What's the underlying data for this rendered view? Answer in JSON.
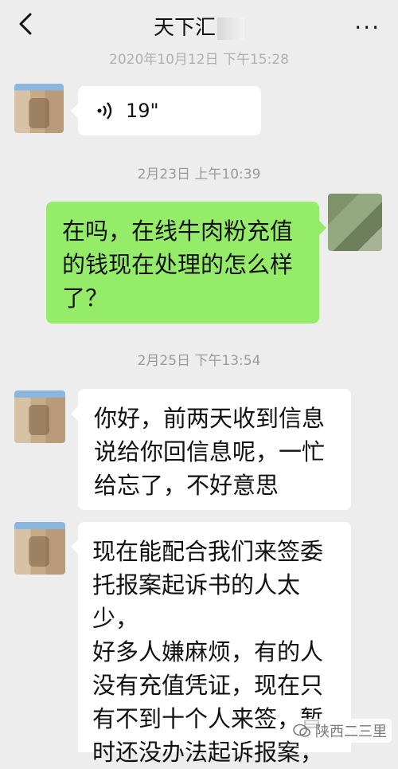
{
  "header": {
    "title": "天下汇",
    "more_label": "···"
  },
  "timestamps": {
    "ts1": "2020年10月12日 下午15:28",
    "ts2": "2月23日 上午10:39",
    "ts3": "2月25日 下午13:54"
  },
  "messages": {
    "voice": {
      "duration": "19\""
    },
    "m1": [
      "在吗，在线牛肉粉充值",
      "的钱现在处理的怎么样",
      "了？"
    ],
    "m2": [
      "你好，前两天收到信息",
      "说给你回信息呢，一忙",
      "给忘了，不好意思"
    ],
    "m3": [
      "现在能配合我们来签委",
      "托报案起诉书的人太少，",
      "好多人嫌麻烦，有的人",
      "没有充值凭证，现在只",
      "有不到十个人来签，暂",
      "时还没办法起诉报案，"
    ]
  },
  "watermark": {
    "text": "陕西二三里"
  }
}
